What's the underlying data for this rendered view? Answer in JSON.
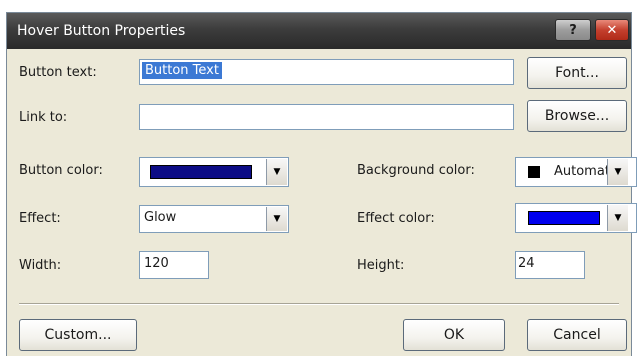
{
  "window": {
    "title": "Hover Button Properties",
    "help_label": "?",
    "close_label": "✕"
  },
  "button_text": {
    "label": "Button text:",
    "value": "Button Text"
  },
  "font_button": "Font...",
  "link_to": {
    "label": "Link to:",
    "value": ""
  },
  "browse_button": "Browse...",
  "button_color": {
    "label": "Button color:",
    "color": "#0c0c86"
  },
  "background_color": {
    "label": "Background color:",
    "value": "Automatic",
    "swatch_color": "#000000"
  },
  "effect": {
    "label": "Effect:",
    "value": "Glow"
  },
  "effect_color": {
    "label": "Effect color:",
    "color": "#0000ee"
  },
  "width": {
    "label": "Width:",
    "value": "120"
  },
  "height": {
    "label": "Height:",
    "value": "24"
  },
  "custom_button": "Custom...",
  "ok_button": "OK",
  "cancel_button": "Cancel",
  "icons": {
    "dropdown": "▼"
  }
}
